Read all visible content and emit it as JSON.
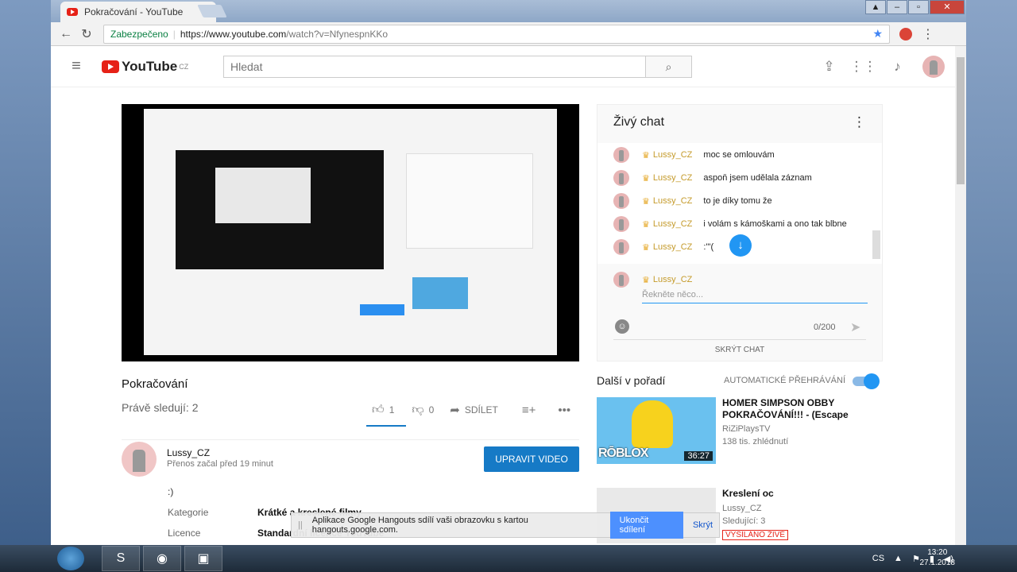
{
  "browser": {
    "tab_title": "Pokračování - YouTube",
    "tab_close": "✕",
    "secure_label": "Zabezpečeno",
    "url_host": "https://www.youtube.com",
    "url_path": "/watch?v=NfynespnKKo"
  },
  "header": {
    "logo_text": "YouTube",
    "logo_region": "CZ",
    "search_placeholder": "Hledat"
  },
  "video": {
    "title": "Pokračování",
    "viewers": "Právě sledují: 2",
    "likes": "1",
    "dislikes": "0",
    "share_label": "SDÍLET"
  },
  "channel": {
    "name": "Lussy_CZ",
    "subtitle": "Přenos začal před 19 minut",
    "edit_button": "UPRAVIT VIDEO",
    "description": ":)",
    "meta": [
      {
        "label": "Kategorie",
        "value": "Krátké a kreslené filmy"
      },
      {
        "label": "Licence",
        "value": "Standardní licence YouTube"
      }
    ]
  },
  "chat": {
    "title": "Živý chat",
    "messages": [
      {
        "author": "Lussy_CZ",
        "text": "moc se omlouvám"
      },
      {
        "author": "Lussy_CZ",
        "text": "aspoň jsem udělala záznam"
      },
      {
        "author": "Lussy_CZ",
        "text": "to je díky tomu že"
      },
      {
        "author": "Lussy_CZ",
        "text": "i volám s kámoškami a ono tak blbne"
      },
      {
        "author": "Lussy_CZ",
        "text": ":'\"("
      }
    ],
    "input_author": "Lussy_CZ",
    "input_placeholder": "Řekněte něco...",
    "counter": "0/200",
    "hide_label": "SKRÝT CHAT"
  },
  "upnext": {
    "title": "Další v pořadí",
    "autoplay_label": "AUTOMATICKÉ PŘEHRÁVÁNÍ",
    "autoplay_on": true,
    "items": [
      {
        "title": "HOMER SIMPSON OBBY POKRAČOVÁNÍ!!! - (Escape",
        "channel": "RiZiPlaysTV",
        "views": "138 tis. zhlédnutí",
        "duration": "36:27",
        "thumb_text": "RŌBLOX"
      },
      {
        "title": "Kreslení oc",
        "channel": "Lussy_CZ",
        "views": "Sledující: 3",
        "badge": "VYSÍLÁNO ŽIVĚ"
      }
    ]
  },
  "hangouts": {
    "message": "Aplikace Google Hangouts sdílí vaši obrazovku s kartou hangouts.google.com.",
    "stop_button": "Ukončit sdílení",
    "hide_button": "Skrýt"
  },
  "taskbar": {
    "language": "CS",
    "time": "13:20",
    "date": "27.1.2018"
  }
}
